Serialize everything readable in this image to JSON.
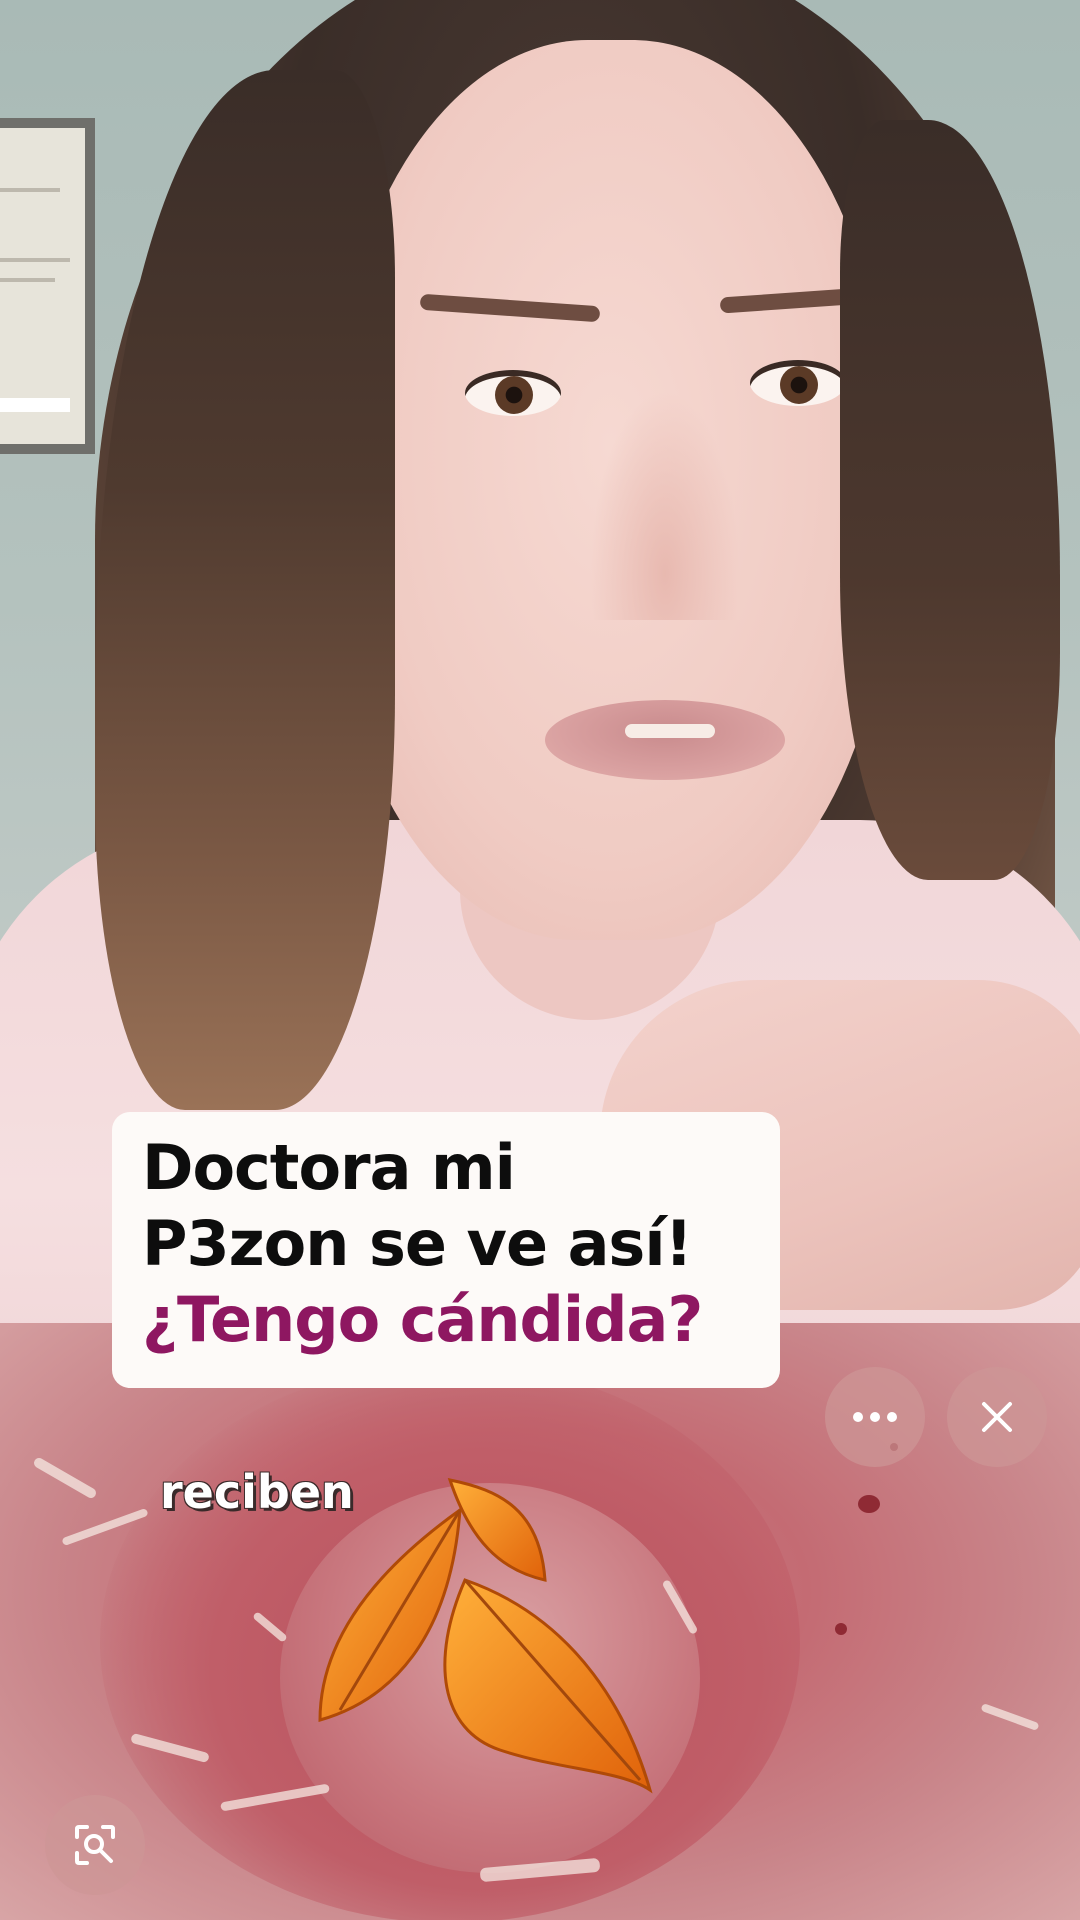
{
  "caption": {
    "line1": "Doctora mi",
    "line2": "P3zon se ve así!",
    "line3": "¿Tengo cándida?",
    "text_color": "#0d0d0d",
    "accent_color": "#8e1761",
    "background": "#fdfaf8"
  },
  "floating_text": "reciben",
  "controls": {
    "more_icon": "more-horizontal-icon",
    "close_icon": "close-icon",
    "lens_icon": "visual-search-icon"
  },
  "sticker": {
    "icon": "autumn-leaves-sticker",
    "color": "#f07a14"
  }
}
